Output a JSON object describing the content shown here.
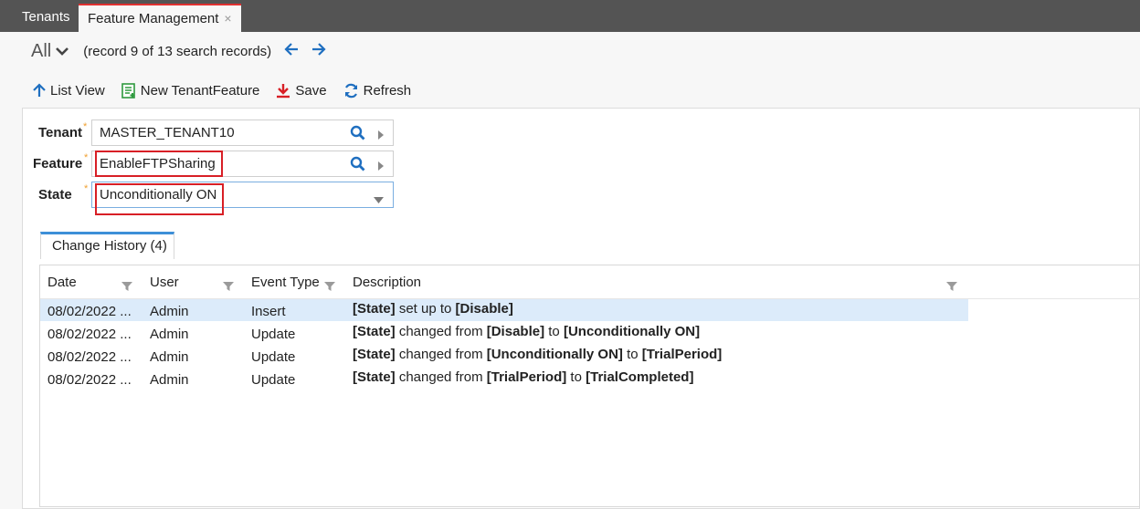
{
  "tabs": {
    "tenants": "Tenants",
    "feature": "Feature Management",
    "close": "×"
  },
  "record_bar": {
    "filter": "All",
    "record_text": "(record 9 of 13 search records)"
  },
  "toolbar": {
    "list_view": "List View",
    "new_item": "New TenantFeature",
    "save": "Save",
    "refresh": "Refresh"
  },
  "form": {
    "tenant": {
      "label": "Tenant",
      "required": "*",
      "value": "MASTER_TENANT10"
    },
    "feature": {
      "label": "Feature",
      "required": "*",
      "value": "EnableFTPSharing"
    },
    "state": {
      "label": "State",
      "required": "*",
      "value": "Unconditionally ON"
    }
  },
  "history_tab": {
    "label": "Change History (4)"
  },
  "grid": {
    "columns": [
      "Date",
      "User",
      "Event Type",
      "Description"
    ],
    "rows": [
      {
        "date": "08/02/2022 ...",
        "user": "Admin",
        "event": "Insert",
        "desc": [
          [
            "[State]",
            true
          ],
          [
            " set up to ",
            false
          ],
          [
            "[Disable]",
            true
          ]
        ]
      },
      {
        "date": "08/02/2022 ...",
        "user": "Admin",
        "event": "Update",
        "desc": [
          [
            "[State]",
            true
          ],
          [
            " changed from ",
            false
          ],
          [
            "[Disable]",
            true
          ],
          [
            " to ",
            false
          ],
          [
            "[Unconditionally ON]",
            true
          ]
        ]
      },
      {
        "date": "08/02/2022 ...",
        "user": "Admin",
        "event": "Update",
        "desc": [
          [
            "[State]",
            true
          ],
          [
            " changed from ",
            false
          ],
          [
            "[Unconditionally ON]",
            true
          ],
          [
            " to ",
            false
          ],
          [
            "[TrialPeriod]",
            true
          ]
        ]
      },
      {
        "date": "08/02/2022 ...",
        "user": "Admin",
        "event": "Update",
        "desc": [
          [
            "[State]",
            true
          ],
          [
            " changed from ",
            false
          ],
          [
            "[TrialPeriod]",
            true
          ],
          [
            " to ",
            false
          ],
          [
            "[TrialCompleted]",
            true
          ]
        ]
      }
    ]
  },
  "colors": {
    "accent": "#1f6fc0",
    "highlight_box": "#d81f26",
    "selected_row": "#dcebfa",
    "tab_bar": "#545454"
  }
}
